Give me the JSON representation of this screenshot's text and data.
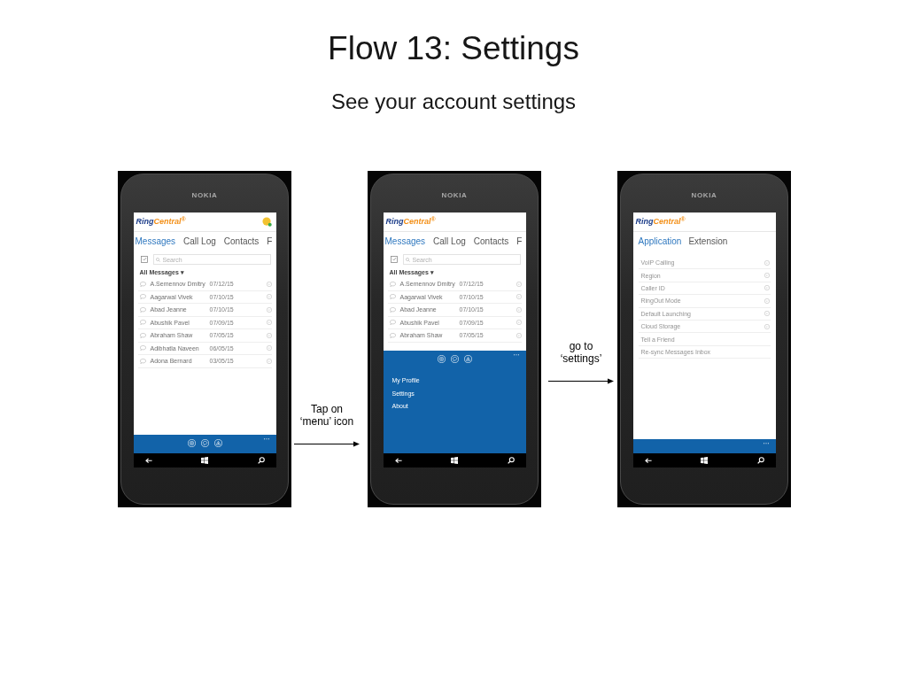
{
  "title": "Flow 13: Settings",
  "subtitle": "See your account settings",
  "flow": [
    {
      "kind": "phone",
      "brand": "NOKIA",
      "screen": {
        "kind": "messages",
        "logo": [
          "Ring",
          "Central$^{®}$"
        ],
        "avatar": true,
        "tabs": [
          {
            "label": "Messages",
            "selected": true
          },
          {
            "label": "Call Log",
            "selected": false
          },
          {
            "label": "Contacts",
            "selected": false
          },
          {
            "label": "F",
            "selected": false
          }
        ],
        "search": {
          "placeholder": "Search"
        },
        "filter": "All Messages ▾",
        "rows": [
          {
            "name": "A.Semennov Dmitry",
            "date": "07/12/15"
          },
          {
            "name": "Aagarwal Vivek",
            "date": "07/10/15"
          },
          {
            "name": "Abad Jeanne",
            "date": "07/10/15"
          },
          {
            "name": "Abushik Pavel",
            "date": "07/09/15"
          },
          {
            "name": "Abraham Shaw",
            "date": "07/05/15"
          },
          {
            "name": "Adibhatla Naveen",
            "date": "06/05/15"
          },
          {
            "name": "Adona Bernard",
            "date": "03/05/15"
          }
        ],
        "app_bar": {
          "expanded": false
        }
      }
    },
    {
      "kind": "arrow",
      "label": "Tap on\n‘menu’ icon"
    },
    {
      "kind": "phone",
      "brand": "NOKIA",
      "screen": {
        "kind": "messages",
        "logo": [
          "Ring",
          "Central$^{®}$"
        ],
        "tabs": [
          {
            "label": "Messages",
            "selected": true
          },
          {
            "label": "Call Log",
            "selected": false
          },
          {
            "label": "Contacts",
            "selected": false
          },
          {
            "label": "F",
            "selected": false
          }
        ],
        "search": {
          "placeholder": "Search"
        },
        "filter": "All Messages ▾",
        "rows": [
          {
            "name": "A.Semennov Dmitry",
            "date": "07/12/15"
          },
          {
            "name": "Aagarwal Vivek",
            "date": "07/10/15"
          },
          {
            "name": "Abad Jeanne",
            "date": "07/10/15"
          },
          {
            "name": "Abushik Pavel",
            "date": "07/09/15"
          },
          {
            "name": "Abraham Shaw",
            "date": "07/05/15"
          }
        ],
        "app_bar": {
          "expanded": true,
          "menu": [
            "My Profile",
            "Settings",
            "About"
          ]
        }
      }
    },
    {
      "kind": "arrow",
      "label": "go to\n‘settings’"
    },
    {
      "kind": "phone",
      "brand": "NOKIA",
      "screen": {
        "kind": "settings",
        "logo": [
          "Ring",
          "Central$^{®}$"
        ],
        "tabs": [
          {
            "label": "Application",
            "selected": true
          },
          {
            "label": "Extension",
            "selected": false
          }
        ],
        "rows": [
          {
            "kind": "option",
            "label": "VoIP Calling"
          },
          {
            "kind": "option",
            "label": "Region"
          },
          {
            "kind": "option",
            "label": "Caller ID"
          },
          {
            "kind": "option",
            "label": "RingOut Mode"
          },
          {
            "kind": "option",
            "label": "Default Launching"
          },
          {
            "kind": "option",
            "label": "Cloud Storage"
          },
          {
            "kind": "action",
            "label": "Tell a Friend"
          },
          {
            "kind": "action",
            "label": "Re-sync Messages Inbox"
          }
        ],
        "app_bar": {
          "expanded": false
        }
      }
    }
  ]
}
